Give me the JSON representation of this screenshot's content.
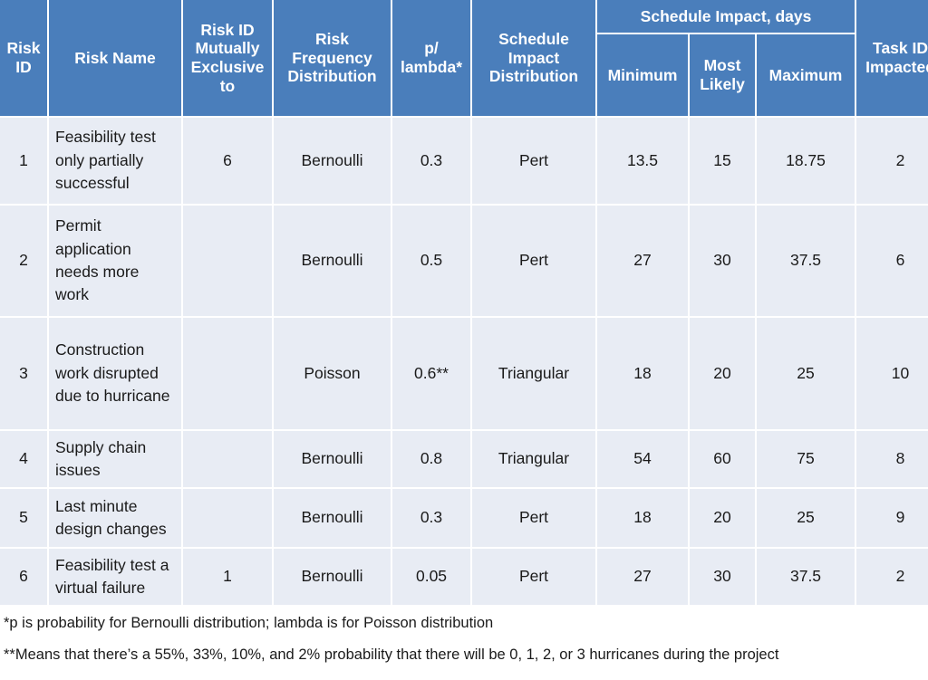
{
  "table": {
    "header": {
      "group_label": "Schedule Impact, days",
      "columns": [
        {
          "key": "risk_id",
          "label": "Risk\nID"
        },
        {
          "key": "risk_name",
          "label": "Risk Name"
        },
        {
          "key": "mutex",
          "label": "Risk ID Mutually Exclusive to"
        },
        {
          "key": "freq_dist",
          "label": "Risk Frequency Distribution"
        },
        {
          "key": "p_lambda",
          "label": "p/ lambda*"
        },
        {
          "key": "imp_dist",
          "label": "Schedule Impact Distribution"
        },
        {
          "key": "minimum",
          "label": "Minimum"
        },
        {
          "key": "most_likely",
          "label": "Most Likely"
        },
        {
          "key": "maximum",
          "label": "Maximum"
        },
        {
          "key": "task_id",
          "label": "Task ID Impacted"
        }
      ],
      "col_risk_id": "Risk ID",
      "col_risk_name": "Risk Name",
      "col_mutex": "Risk ID Mutually Exclusive to",
      "col_freq_dist": "Risk Frequency Distribution",
      "col_p_lambda": "p/ lambda*",
      "col_imp_dist": "Schedule Impact Distribution",
      "col_minimum": "Minimum",
      "col_most_likely": "Most Likely",
      "col_maximum": "Maximum",
      "col_task_id": "Task ID Impacted"
    },
    "rows": [
      {
        "risk_id": "1",
        "risk_name": "Feasibility test only partially successful",
        "mutex": "6",
        "freq_dist": "Bernoulli",
        "p_lambda": "0.3",
        "imp_dist": "Pert",
        "minimum": "13.5",
        "most_likely": "15",
        "maximum": "18.75",
        "task_id": "2"
      },
      {
        "risk_id": "2",
        "risk_name": "Permit application needs more work",
        "mutex": "",
        "freq_dist": "Bernoulli",
        "p_lambda": "0.5",
        "imp_dist": "Pert",
        "minimum": "27",
        "most_likely": "30",
        "maximum": "37.5",
        "task_id": "6"
      },
      {
        "risk_id": "3",
        "risk_name": "Construction work disrupted due to hurricane",
        "mutex": "",
        "freq_dist": "Poisson",
        "p_lambda": "0.6**",
        "imp_dist": "Triangular",
        "minimum": "18",
        "most_likely": "20",
        "maximum": "25",
        "task_id": "10"
      },
      {
        "risk_id": "4",
        "risk_name": "Supply chain issues",
        "mutex": "",
        "freq_dist": "Bernoulli",
        "p_lambda": "0.8",
        "imp_dist": "Triangular",
        "minimum": "54",
        "most_likely": "60",
        "maximum": "75",
        "task_id": "8"
      },
      {
        "risk_id": "5",
        "risk_name": "Last minute design changes",
        "mutex": "",
        "freq_dist": "Bernoulli",
        "p_lambda": "0.3",
        "imp_dist": "Pert",
        "minimum": "18",
        "most_likely": "20",
        "maximum": "25",
        "task_id": "9"
      },
      {
        "risk_id": "6",
        "risk_name": "Feasibility test a virtual failure",
        "mutex": "1",
        "freq_dist": "Bernoulli",
        "p_lambda": "0.05",
        "imp_dist": "Pert",
        "minimum": "27",
        "most_likely": "30",
        "maximum": "37.5",
        "task_id": "2"
      }
    ]
  },
  "notes": {
    "footnote_1": "*p is probability for Bernoulli distribution; lambda is for Poisson distribution",
    "footnote_2": "**Means that there’s a 55%, 33%, 10%, and 2% probability that there will be 0, 1, 2, or 3 hurricanes during the project"
  },
  "colors": {
    "header_blue": "#4a7ebb",
    "cell_fill": "#e8ecf4",
    "page_background": "#ffffff",
    "header_text": "#ffffff",
    "body_text": "#1a1a1a"
  }
}
